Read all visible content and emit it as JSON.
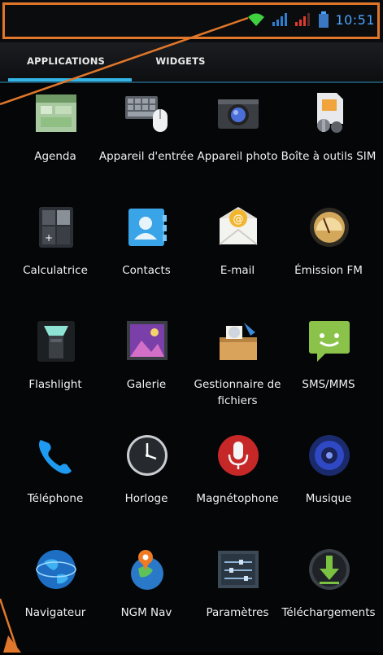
{
  "status_bar": {
    "time": "10:51",
    "icons": [
      "wifi-icon",
      "signal-strength-icon",
      "signal-strength-alert-icon",
      "battery-icon"
    ]
  },
  "tabs": [
    {
      "label": "APPLICATIONS",
      "selected": true
    },
    {
      "label": "WIDGETS",
      "selected": false
    }
  ],
  "apps": [
    {
      "label": "Agenda",
      "icon": "calendar-icon"
    },
    {
      "label": "Appareil d'entrée",
      "icon": "keyboard-mouse-icon"
    },
    {
      "label": "Appareil photo",
      "icon": "camera-icon"
    },
    {
      "label": "Boîte à outils SIM",
      "icon": "sim-toolkit-icon"
    },
    {
      "label": "Calculatrice",
      "icon": "calculator-icon"
    },
    {
      "label": "Contacts",
      "icon": "contacts-icon"
    },
    {
      "label": "E-mail",
      "icon": "email-icon"
    },
    {
      "label": "Émission FM",
      "icon": "fm-transmitter-icon"
    },
    {
      "label": "Flashlight",
      "icon": "flashlight-icon"
    },
    {
      "label": "Galerie",
      "icon": "gallery-icon"
    },
    {
      "label": "Gestionnaire de fichiers",
      "icon": "file-manager-icon"
    },
    {
      "label": "SMS/MMS",
      "icon": "messaging-icon"
    },
    {
      "label": "Téléphone",
      "icon": "phone-icon"
    },
    {
      "label": "Horloge",
      "icon": "clock-icon"
    },
    {
      "label": "Magnétophone",
      "icon": "microphone-icon"
    },
    {
      "label": "Musique",
      "icon": "music-icon"
    },
    {
      "label": "Navigateur",
      "icon": "globe-icon"
    },
    {
      "label": "NGM Nav",
      "icon": "navigation-icon"
    },
    {
      "label": "Paramètres",
      "icon": "settings-icon"
    },
    {
      "label": "Téléchargements",
      "icon": "download-icon"
    }
  ],
  "colors": {
    "accent": "#33b5e5",
    "clock": "#4da3ff",
    "annotation": "#e0772a"
  }
}
